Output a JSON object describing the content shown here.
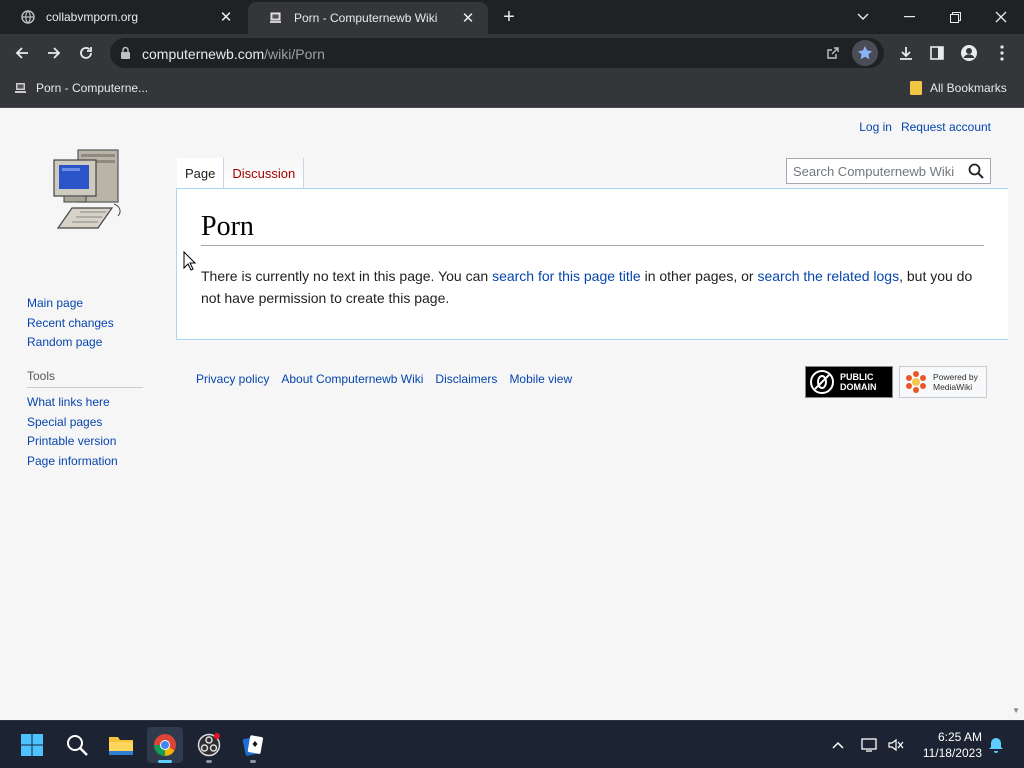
{
  "browser": {
    "tabs": [
      {
        "title": "collabvmporn.org"
      },
      {
        "title": "Porn - Computernewb Wiki"
      }
    ],
    "url_host": "computernewb.com",
    "url_path": "/wiki/Porn",
    "bookmarks": {
      "item": "Porn - Computerne...",
      "all": "All Bookmarks"
    }
  },
  "wiki": {
    "user_links": {
      "login": "Log in",
      "request": "Request account"
    },
    "tabs": {
      "page": "Page",
      "discussion": "Discussion"
    },
    "search_placeholder": "Search Computernewb Wiki",
    "title": "Porn",
    "body": {
      "t1": "There is currently no text in this page. You can ",
      "link1": "search for this page title",
      "t2": " in other pages, or ",
      "link2": "search the related logs",
      "t3": ", but you do not have permission to create this page."
    },
    "nav": [
      "Main page",
      "Recent changes",
      "Random page"
    ],
    "tools_heading": "Tools",
    "tools": [
      "What links here",
      "Special pages",
      "Printable version",
      "Page information"
    ],
    "footer": [
      "Privacy policy",
      "About Computernewb Wiki",
      "Disclaimers",
      "Mobile view"
    ],
    "badges": {
      "pd": "PUBLIC DOMAIN",
      "mw_top": "Powered by",
      "mw_bottom": "MediaWiki"
    }
  },
  "taskbar": {
    "time": "6:25 AM",
    "date": "11/18/2023"
  },
  "colors": {
    "link": "#0645ad",
    "new_link": "#a40000",
    "accent": "#60cdff",
    "star": "#8ab4f8"
  }
}
